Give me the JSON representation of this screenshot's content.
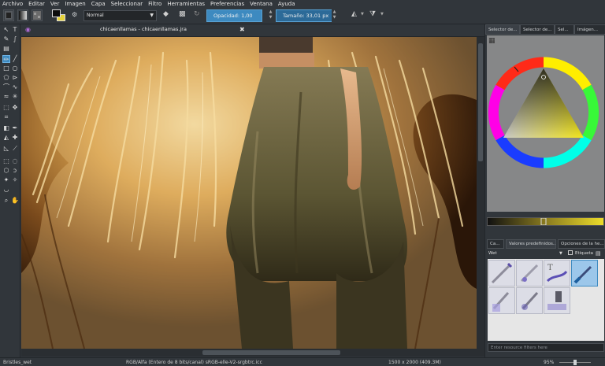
{
  "menu": [
    "Archivo",
    "Editar",
    "Ver",
    "Imagen",
    "Capa",
    "Seleccionar",
    "Filtro",
    "Herramientas",
    "Preferencias",
    "Ventana",
    "Ayuda"
  ],
  "toolbar": {
    "blend_mode": "Normal",
    "opacity_label": "Opacidad: 1,00",
    "size_label": "Tamaño: 33,01 px"
  },
  "document": {
    "tab_title": "chicaenllamas - chicaenllamas.jra"
  },
  "dock": {
    "top_tabs": [
      "Selector de...",
      "Selector de...",
      "Sel...",
      "Imágen..."
    ],
    "bottom_tabs": [
      "Ca...",
      "Valores predefinidos...",
      "Opciones de la he..."
    ],
    "preset_tag": "Wet",
    "tag_checkbox_label": "Etiqueta",
    "filter_placeholder": "Enter resource filters here"
  },
  "status": {
    "brush": "Bristles_wet",
    "color_space": "RGB/Alfa (Entero de 8 bits/canal)  sRGB-elle-V2-srgbtrc.icc",
    "dimensions": "1500 x 2000 (409.3M)",
    "zoom": "95%"
  },
  "colors": {
    "accent": "#3d8ac0",
    "panel": "#31363b",
    "selector_bg": "#868788"
  }
}
